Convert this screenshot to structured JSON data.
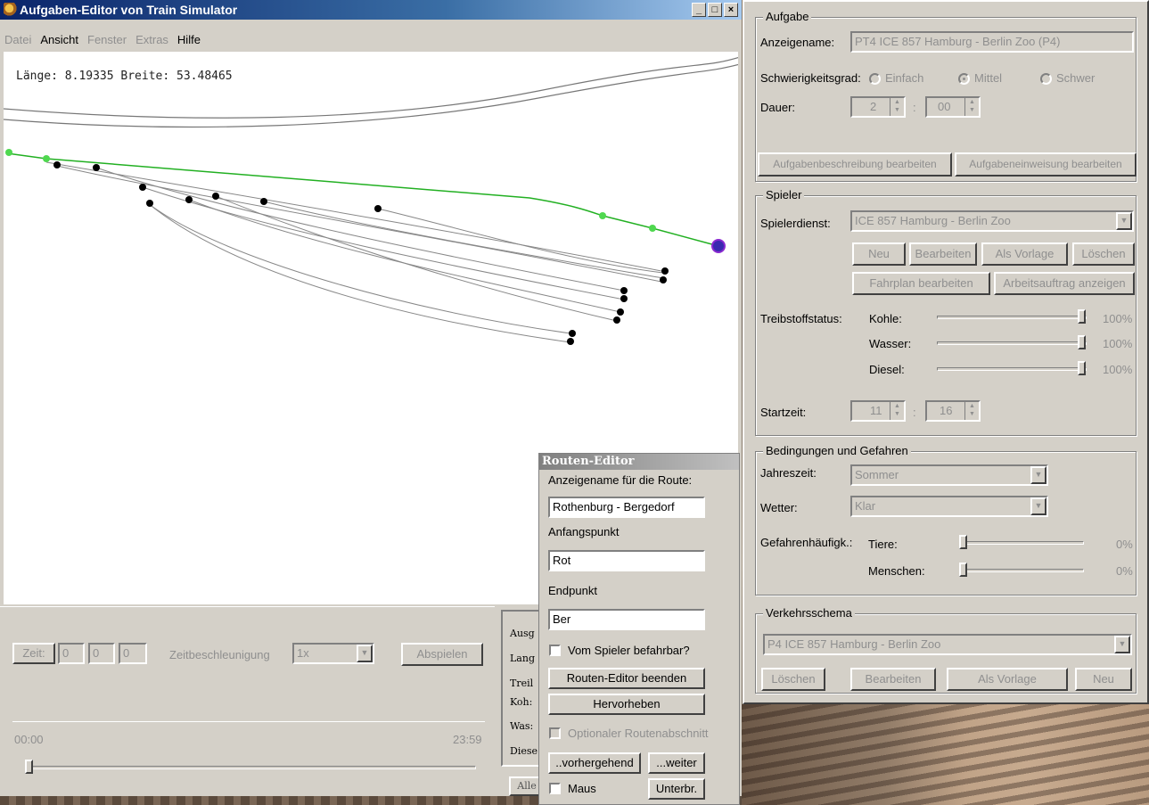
{
  "window": {
    "title": "Aufgaben-Editor von Train Simulator",
    "controls": [
      "_",
      "□",
      "×"
    ],
    "menu": [
      {
        "label": "Datei",
        "enabled": false
      },
      {
        "label": "Ansicht",
        "enabled": true
      },
      {
        "label": "Fenster",
        "enabled": false
      },
      {
        "label": "Extras",
        "enabled": false
      },
      {
        "label": "Hilfe",
        "enabled": true
      }
    ]
  },
  "map": {
    "coords": "Länge: 8.19335 Breite: 53.48465"
  },
  "timebar": {
    "time_button": "Zeit:",
    "hours": "0",
    "minutes": "0",
    "seconds": "0",
    "accel_label": "Zeitbeschleunigung",
    "accel_value": "1x",
    "play_button": "Abspielen",
    "start_time": "00:00",
    "end_time": "23:59",
    "slider_position": 0
  },
  "info_panel": {
    "rows": [
      "Ausg",
      "Lang",
      "Treil",
      "Koh:",
      "Was:",
      "Diese"
    ],
    "button": "Alle"
  },
  "aufgabe": {
    "title": "Aufgabe",
    "name_label": "Anzeigename:",
    "name_value": "PT4 ICE 857 Hamburg - Berlin Zoo (P4)",
    "difficulty_label": "Schwierigkeitsgrad:",
    "difficulty_options": [
      "Einfach",
      "Mittel",
      "Schwer"
    ],
    "difficulty_selected": "Mittel",
    "duration_label": "Dauer:",
    "duration_hours": "2",
    "duration_minutes": "00",
    "edit_description_button": "Aufgabenbeschreibung bearbeiten",
    "edit_briefing_button": "Aufgabeneinweisung bearbeiten"
  },
  "spieler": {
    "title": "Spieler",
    "service_label": "Spielerdienst:",
    "service_value": "ICE 857 Hamburg - Berlin Zoo",
    "buttons": [
      "Neu",
      "Bearbeiten",
      "Als Vorlage",
      "Löschen"
    ],
    "timetable_button": "Fahrplan bearbeiten",
    "work_order_button": "Arbeitsauftrag anzeigen",
    "fuel_label": "Treibstoffstatus:",
    "fuel": [
      {
        "label": "Kohle:",
        "value": "100%",
        "level": 100
      },
      {
        "label": "Wasser:",
        "value": "100%",
        "level": 100
      },
      {
        "label": "Diesel:",
        "value": "100%",
        "level": 100
      }
    ],
    "start_label": "Startzeit:",
    "start_hour": "11",
    "start_minute": "16"
  },
  "conditions": {
    "title": "Bedingungen und Gefahren",
    "season_label": "Jahreszeit:",
    "season_value": "Sommer",
    "weather_label": "Wetter:",
    "weather_value": "Klar",
    "hazard_label": "Gefahrenhäufigk.:",
    "hazards": [
      {
        "label": "Tiere:",
        "value": "0%",
        "level": 0
      },
      {
        "label": "Menschen:",
        "value": "0%",
        "level": 0
      }
    ]
  },
  "traffic": {
    "title": "Verkehrsschema",
    "value": "P4 ICE 857 Hamburg - Berlin Zoo",
    "buttons": [
      "Löschen",
      "Bearbeiten",
      "Als Vorlage",
      "Neu"
    ]
  },
  "route_editor": {
    "title": "Routen-Editor",
    "name_label": "Anzeigename für die Route:",
    "name_value": "Rothenburg - Bergedorf",
    "start_label": "Anfangspunkt",
    "start_value": "Rot",
    "end_label": "Endpunkt",
    "end_value": "Ber",
    "drivable_label": "Vom Spieler befahrbar?",
    "drivable_checked": false,
    "close_button": "Routen-Editor beenden",
    "highlight_button": "Hervorheben",
    "optional_label": "Optionaler Routenabschnitt",
    "prev_button": "..vorhergehend",
    "next_button": "...weiter",
    "mouse_label": "Maus",
    "mouse_checked": false,
    "interrupt_button": "Unterbr."
  },
  "colors": {
    "titlebar_start": "#0a246a",
    "titlebar_end": "#a6caf0",
    "route_line": "#22b022",
    "track_line": "#777777",
    "end_marker": "#3a2ab0"
  }
}
